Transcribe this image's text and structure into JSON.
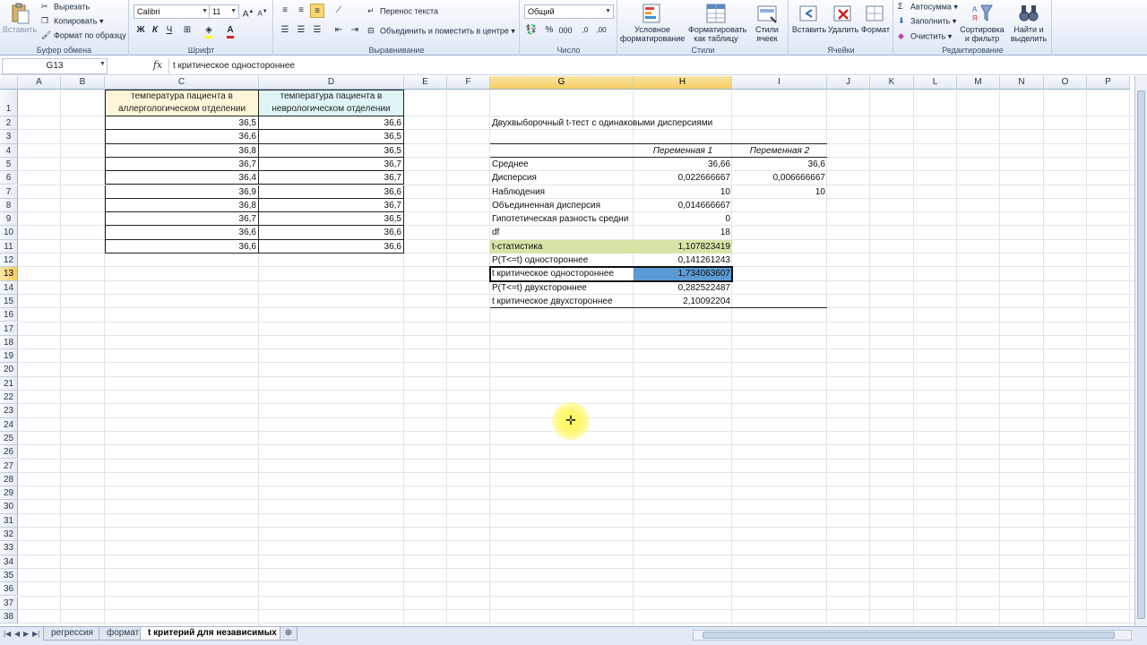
{
  "ribbon": {
    "clipboard": {
      "paste": "Вставить",
      "cut": "Вырезать",
      "copy": "Копировать",
      "format_painter": "Формат по образцу",
      "label": "Буфер обмена"
    },
    "font": {
      "family": "Calibri",
      "size": "11",
      "bold": "Ж",
      "italic": "К",
      "underline": "Ч",
      "label": "Шрифт"
    },
    "alignment": {
      "wrap": "Перенос текста",
      "merge": "Объединить и поместить в центре",
      "label": "Выравнивание"
    },
    "number": {
      "format": "Общий",
      "label": "Число"
    },
    "styles": {
      "conditional": "Условное форматирование",
      "as_table": "Форматировать как таблицу",
      "cell_styles": "Стили ячеек",
      "label": "Стили"
    },
    "cells": {
      "insert": "Вставить",
      "delete": "Удалить",
      "format": "Формат",
      "label": "Ячейки"
    },
    "editing": {
      "autosum": "Автосумма",
      "fill": "Заполнить",
      "clear": "Очистить",
      "sort": "Сортировка и фильтр",
      "find": "Найти и выделить",
      "label": "Редактирование"
    }
  },
  "formula_bar": {
    "name_box": "G13",
    "fx": "fx",
    "content": "t критическое одностороннее"
  },
  "columns": [
    "A",
    "B",
    "C",
    "D",
    "E",
    "F",
    "G",
    "H",
    "I",
    "J",
    "K",
    "L",
    "M",
    "N",
    "O",
    "P"
  ],
  "rows": [
    "1",
    "2",
    "3",
    "4",
    "5",
    "6",
    "7",
    "8",
    "9",
    "10",
    "11",
    "12",
    "13",
    "14",
    "15",
    "16",
    "17",
    "18",
    "19",
    "20",
    "21",
    "22",
    "23",
    "24",
    "25",
    "26",
    "27",
    "28",
    "29",
    "30",
    "31",
    "32",
    "33",
    "34",
    "35",
    "36",
    "37",
    "38"
  ],
  "input_table": {
    "header_c": "температура пациента в аллергологическом отделении",
    "header_d": "температура пациента в неврологическом отделении",
    "col_c": [
      "36,5",
      "36,6",
      "36,8",
      "36,7",
      "36,4",
      "36,9",
      "36,8",
      "36,7",
      "36,6",
      "36,6"
    ],
    "col_d": [
      "36,6",
      "36,5",
      "36,5",
      "36,7",
      "36,7",
      "36,6",
      "36,7",
      "36,5",
      "36,6",
      "36,6"
    ]
  },
  "ttest": {
    "title": "Двухвыборочный t-тест с одинаковыми дисперсиями",
    "var1": "Переменная 1",
    "var2": "Переменная 2",
    "rows": [
      {
        "label": "Среднее",
        "v1": "36,66",
        "v2": "36,6"
      },
      {
        "label": "Дисперсия",
        "v1": "0,022666667",
        "v2": "0,006666667"
      },
      {
        "label": "Наблюдения",
        "v1": "10",
        "v2": "10"
      },
      {
        "label": "Объединенная дисперсия",
        "v1": "0,014666667",
        "v2": ""
      },
      {
        "label": "Гипотетическая разность средни",
        "v1": "0",
        "v2": ""
      },
      {
        "label": "df",
        "v1": "18",
        "v2": ""
      },
      {
        "label": "t-статистика",
        "v1": "1,107823419",
        "v2": ""
      },
      {
        "label": "P(T<=t) одностороннее",
        "v1": "0,141261243",
        "v2": ""
      },
      {
        "label": "t критическое одностороннее",
        "v1": "1,734063607",
        "v2": ""
      },
      {
        "label": "P(T<=t) двухстороннее",
        "v1": "0,282522487",
        "v2": ""
      },
      {
        "label": "t критическое двухстороннее",
        "v1": "2,10092204",
        "v2": ""
      }
    ]
  },
  "sheet_tabs": [
    "регрессия",
    "формат",
    "t критерий для независимых"
  ],
  "colors": {
    "highlight_green": "#d6e4a6",
    "selection_blue": "#5b9bd5",
    "header_sel": "#f5cc61"
  }
}
